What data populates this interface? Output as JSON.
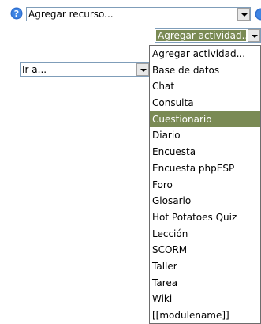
{
  "add_resource": {
    "value": "Agregar recurso..."
  },
  "add_activity": {
    "value": "Agregar actividad..."
  },
  "jump_to": {
    "value": "Ir a..."
  },
  "activity_options": [
    "Agregar actividad...",
    "Base de datos",
    "Chat",
    "Consulta",
    "Cuestionario",
    "Diario",
    "Encuesta",
    "Encuesta phpESP",
    "Foro",
    "Glosario",
    "Hot Potatoes Quiz",
    "Lección",
    "SCORM",
    "Taller",
    "Tarea",
    "Wiki",
    "[[modulename]]"
  ],
  "highlighted_option": "Cuestionario",
  "colors": {
    "highlight": "#7a8a54",
    "help_icon": "#2f6fcf"
  },
  "icons": [
    "help-icon",
    "chevron-down-icon"
  ]
}
